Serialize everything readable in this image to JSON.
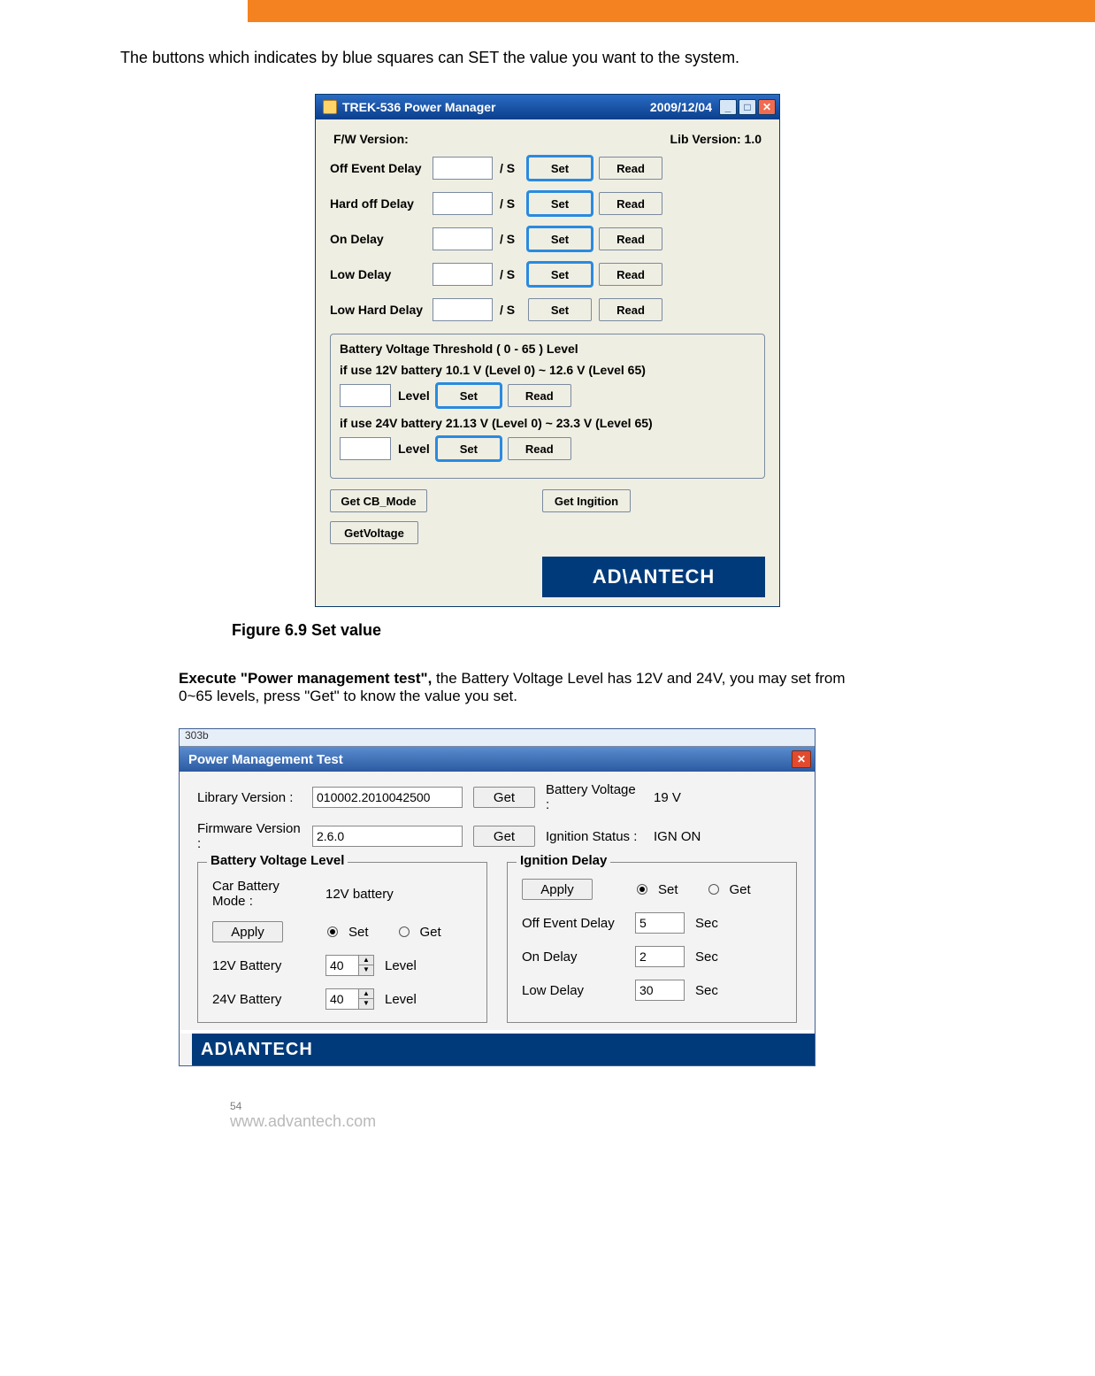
{
  "intro": "The buttons which indicates by blue squares can SET the value you want to the system.",
  "win1": {
    "title": "TREK-536 Power Manager",
    "date": "2009/12/04",
    "fw_label": "F/W Version:",
    "lib_label": "Lib Version: 1.0",
    "delays": [
      {
        "label": "Off Event  Delay",
        "unit": "/ S",
        "set": "Set",
        "read": "Read",
        "blue": true
      },
      {
        "label": "Hard off  Delay",
        "unit": "/ S",
        "set": "Set",
        "read": "Read",
        "blue": true
      },
      {
        "label": "On  Delay",
        "unit": "/ S",
        "set": "Set",
        "read": "Read",
        "blue": true
      },
      {
        "label": "Low  Delay",
        "unit": "/ S",
        "set": "Set",
        "read": "Read",
        "blue": true
      },
      {
        "label": "Low Hard  Delay",
        "unit": "/ S",
        "set": "Set",
        "read": "Read",
        "blue": false
      }
    ],
    "panel": {
      "title": "Battery Voltage Threshold  ( 0 - 65 ) Level",
      "r12": "if use 12V battery     10.1 V (Level 0)  ~  12.6 V (Level 65)",
      "r24": "if use 24V battery     21.13 V (Level 0)  ~  23.3 V (Level 65)",
      "level": "Level",
      "set": "Set",
      "read": "Read"
    },
    "bottom": {
      "getcb": "Get CB_Mode",
      "getign": "Get Ingition",
      "getv": "GetVoltage",
      "logo": "AD\\ANTECH"
    }
  },
  "caption1": "Figure 6.9 Set value",
  "para2_bold": "Execute \"Power management test\",",
  "para2_rest": " the Battery Voltage Level has 12V and 24V, you may set from 0~65 levels, press \"Get\" to know the value you set.",
  "win2": {
    "hint": "303b",
    "title": "Power Management Test",
    "top": {
      "lib_label": "Library Version :",
      "lib_val": "010002.2010042500",
      "fw_label": "Firmware Version :",
      "fw_val": "2.6.0",
      "get": "Get",
      "bv_label": "Battery Voltage :",
      "bv_val": "19 V",
      "ig_label": "Ignition Status :",
      "ig_val": "IGN ON"
    },
    "g1": {
      "title": "Battery Voltage Level",
      "mode_label": "Car Battery Mode :",
      "mode_val": "12V battery",
      "apply": "Apply",
      "set": "Set",
      "get": "Get",
      "b12_label": "12V Battery",
      "b12_val": "40",
      "b24_label": "24V Battery",
      "b24_val": "40",
      "level": "Level"
    },
    "g2": {
      "title": "Ignition Delay",
      "apply": "Apply",
      "set": "Set",
      "get": "Get",
      "off_label": "Off Event Delay",
      "off_val": "5",
      "on_label": "On Delay",
      "on_val": "2",
      "low_label": "Low Delay",
      "low_val": "30",
      "sec": "Sec"
    },
    "logo": "AD\\ANTECH"
  },
  "footer": {
    "page": "54",
    "url": "www.advantech.com"
  }
}
